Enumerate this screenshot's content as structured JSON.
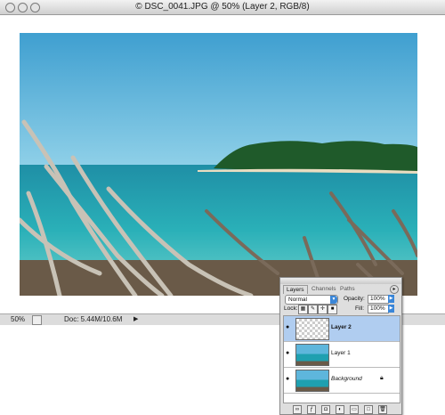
{
  "window": {
    "title": "© DSC_0041.JPG @ 50% (Layer 2, RGB/8)"
  },
  "status": {
    "zoom": "50%",
    "doc_info": "Doc: 5.44M/10.6M"
  },
  "layers_panel": {
    "tabs": [
      "Layers",
      "Channels",
      "Paths"
    ],
    "blend_mode": "Normal",
    "opacity_label": "Opacity:",
    "opacity_value": "100%",
    "lock_label": "Lock:",
    "fill_label": "Fill:",
    "fill_value": "100%",
    "layers": [
      {
        "name": "Layer 2",
        "selected": true
      },
      {
        "name": "Layer 1",
        "selected": false
      },
      {
        "name": "Background",
        "selected": false,
        "locked": true
      }
    ]
  },
  "colors": {
    "selection": "#b0cdf0",
    "accent_blue": "#3a86d8",
    "panel_bg": "#dedede"
  }
}
